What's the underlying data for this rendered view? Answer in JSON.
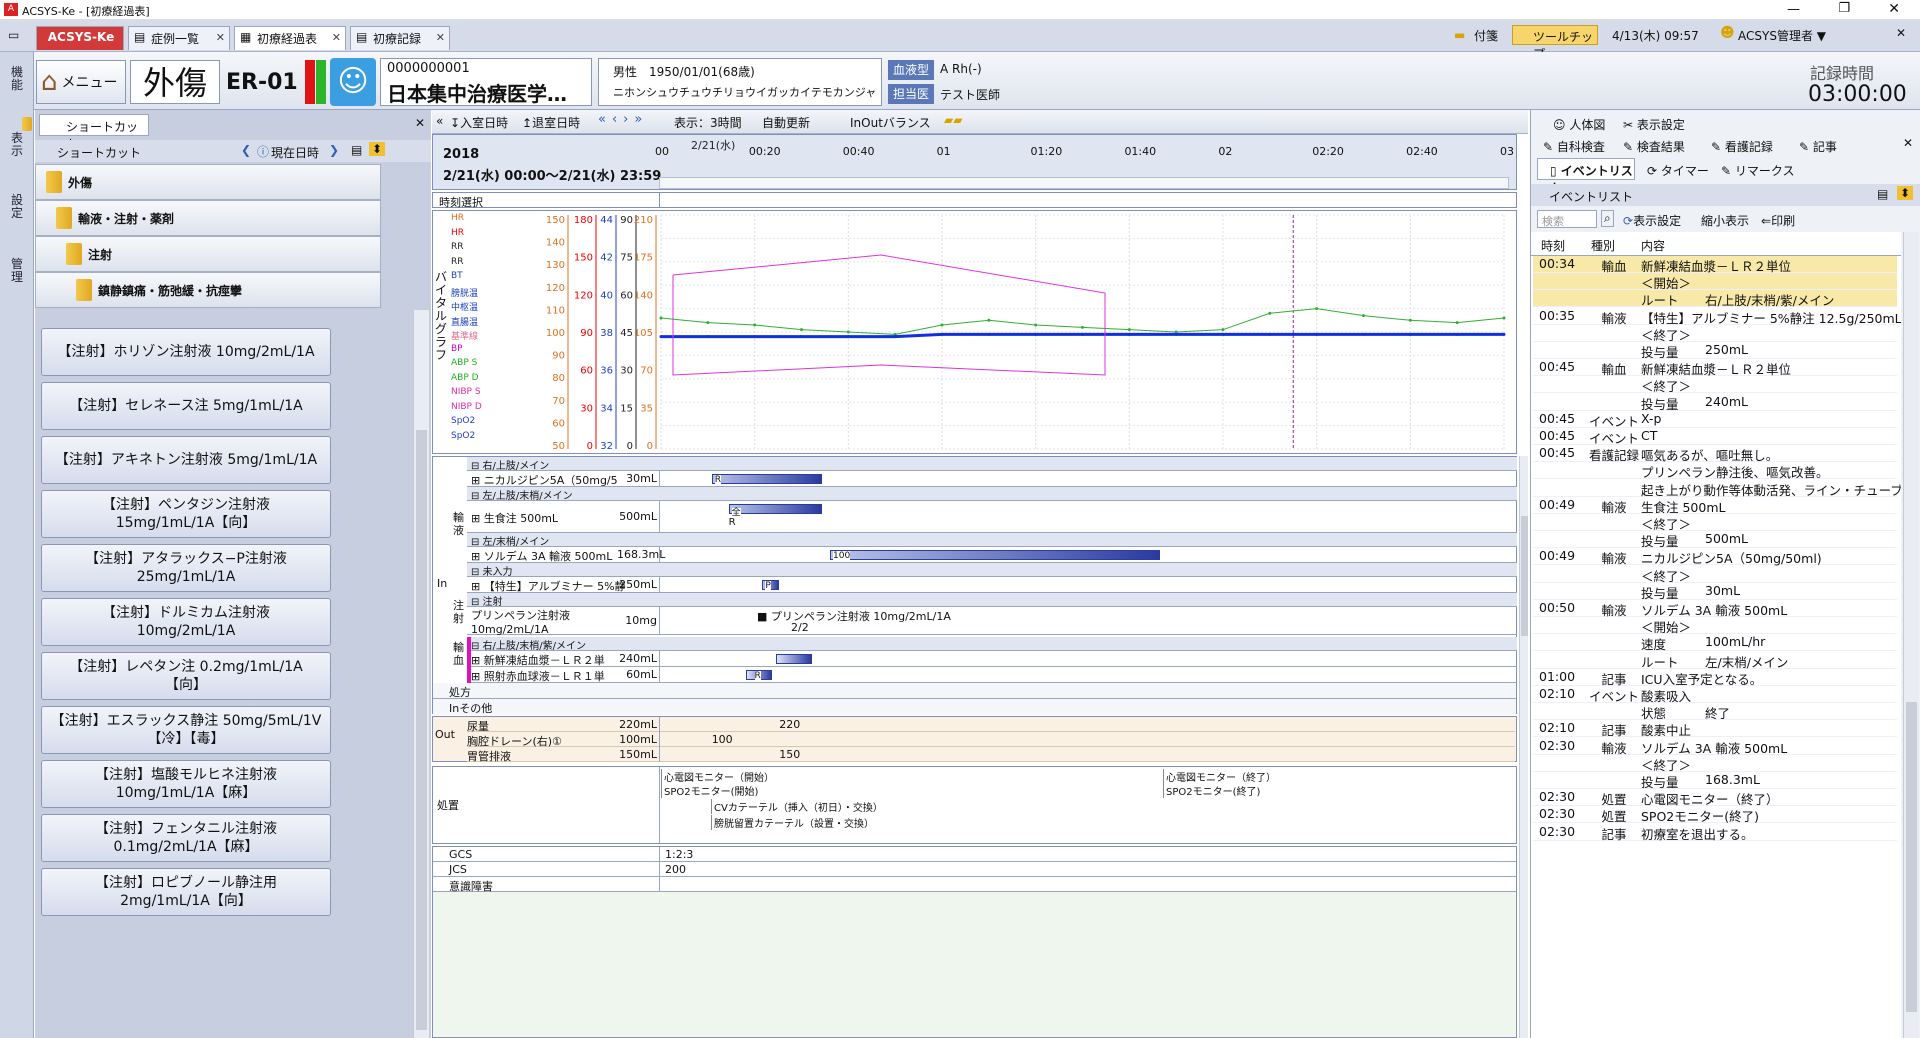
{
  "window": {
    "title": "ACSYS-Ke - [初療経過表]"
  },
  "tabs": [
    {
      "label": "ACSYS-Ke"
    },
    {
      "label": "症例一覧"
    },
    {
      "label": "初療経過表"
    },
    {
      "label": "初療記録"
    }
  ],
  "topright": {
    "attach": "付箋",
    "tooltip": "ツールチップ",
    "datetime": "4/13(木) 09:57",
    "user": "ACSYS管理者 ▼"
  },
  "header": {
    "menu": "メニュー",
    "dept": "外傷",
    "room": "ER-01",
    "patient_id": "0000000001",
    "patient_name": "日本集中治療医学…",
    "sex_dob": "男性　1950/01/01(68歳)",
    "kana": "ニホンシュウチュウチリョウイガッカイテモカンジャ",
    "blood_label": "血液型",
    "blood_value": "A Rh(-)",
    "doctor_label": "担当医",
    "doctor_value": "テスト医師",
    "record_time_label": "記録時間",
    "record_time_value": "03:00:00"
  },
  "left_vertical": [
    "機能",
    "表示",
    "設定",
    "管理"
  ],
  "shortcut": {
    "tab": "ショートカット",
    "header": "ショートカット",
    "now": "現在日時",
    "categories": [
      "外傷",
      "輸液・注射・薬剤",
      "注射",
      "鎮静鎮痛・筋弛緩・抗痙攣"
    ],
    "items": [
      "【注射】ホリゾン注射液 10mg/2mL/1A",
      "【注射】セレネース注 5mg/1mL/1A",
      "【注射】アキネトン注射液 5mg/1mL/1A",
      "【注射】ペンタジン注射液\n15mg/1mL/1A【向】",
      "【注射】アタラックス−P注射液\n25mg/1mL/1A",
      "【注射】ドルミカム注射液\n10mg/2mL/1A",
      "【注射】レペタン注 0.2mg/1mL/1A\n【向】",
      "【注射】エスラックス静注 50mg/5mL/1V\n【冷】【毒】",
      "【注射】塩酸モルヒネ注射液\n10mg/1mL/1A【麻】",
      "【注射】フェンタニル注射液\n0.1mg/2mL/1A【麻】",
      "【注射】ロピブノール静注用\n2mg/1mL/1A【向】"
    ]
  },
  "toolbar": {
    "in_time": "入室日時",
    "out_time": "退室日時",
    "display": "表示：3時間",
    "auto": "自動更新",
    "balance": "InOutバランス"
  },
  "timeline": {
    "year": "2018",
    "range": "2/21(水) 00:00〜2/21(水) 23:59",
    "date_marker": "2/21(水)",
    "ticks": [
      "00",
      "00:20",
      "00:40",
      "01",
      "01:20",
      "01:40",
      "02",
      "02:20",
      "02:40",
      "03"
    ]
  },
  "chart_section": {
    "time_select": "時刻選択",
    "vital_label": "バイタルグラフ",
    "legend": [
      "HR",
      "HR",
      "RR",
      "RR",
      "BT",
      "膀胱温",
      "中枢温",
      "直腸温",
      "基準線",
      "BP",
      "ABP S",
      "ABP D",
      "NIBP S",
      "NIBP D",
      "SpO2",
      "SpO2"
    ],
    "axis1": [
      "150",
      "140",
      "130",
      "120",
      "110",
      "100",
      "90",
      "80",
      "70",
      "60",
      "50"
    ],
    "axis2": [
      "180",
      "150",
      "120",
      "90",
      "60",
      "30",
      "0"
    ],
    "axis3": [
      "44",
      "42",
      "40",
      "38",
      "36",
      "34",
      "32"
    ],
    "axis4": [
      "90",
      "75",
      "60",
      "45",
      "30",
      "15",
      "0"
    ],
    "axis5": [
      "210",
      "175",
      "140",
      "105",
      "70",
      "35",
      "0"
    ]
  },
  "chart_data": {
    "type": "line",
    "title": "",
    "x": [
      "00:00",
      "00:10",
      "00:20",
      "00:30",
      "00:40",
      "00:50",
      "01:00",
      "01:10",
      "01:20",
      "01:30",
      "01:40",
      "01:50",
      "02:00",
      "02:10",
      "02:20",
      "02:30",
      "02:40",
      "02:50",
      "03:00"
    ],
    "series": [
      {
        "name": "HR",
        "values": [
          106,
          104,
          103,
          101,
          100,
          99,
          103,
          105,
          103,
          102,
          101,
          100,
          101,
          108,
          110,
          107,
          105,
          104,
          106
        ]
      },
      {
        "name": "SpO2",
        "values": [
          98,
          98,
          98,
          98,
          98,
          98,
          99,
          99,
          99,
          99,
          99,
          99,
          99,
          99,
          99,
          99,
          99,
          99,
          99
        ]
      }
    ],
    "ylim": [
      50,
      150
    ]
  },
  "infusion": {
    "group_label": "輸液",
    "in_label": "In",
    "rows": [
      {
        "route": "右/上肢/メイン",
        "name": "ニカルジピン5A（50mg/5",
        "vol": "30mL",
        "mark": "R"
      },
      {
        "route": "左/上肢/末梢/メイン",
        "name": "生食注 500mL",
        "vol": "500mL",
        "mark": "全",
        "mark2": "R"
      },
      {
        "route": "左/末梢/メイン",
        "name": "ソルデム 3A 輸液 500mL",
        "vol": "168.3mL",
        "mark": "100"
      },
      {
        "route": "未入力",
        "name": "【特生】アルブミナー 5%静",
        "vol": "250mL",
        "mark": "P"
      }
    ],
    "inj_group": "注射",
    "inj_sub": "注射",
    "inj_name": "プリンペラン注射液\n10mg/2mL/1A",
    "inj_vol": "10mg",
    "inj_bar": "プリンペラン注射液 10mg/2mL/1A",
    "inj_count": "2/2",
    "tr_group": "輸血",
    "tr_route": "右/上肢/末梢/紫/メイン",
    "tr_rows": [
      {
        "name": "新鮮凍結血漿－ＬＲ２単",
        "vol": "240mL"
      },
      {
        "name": "照射赤血球液－ＬＲ１単",
        "vol": "60mL",
        "mark": "R"
      }
    ],
    "rx": "処方",
    "in_other": "Inその他"
  },
  "out": {
    "label": "Out",
    "rows": [
      {
        "name": "尿量",
        "vol": "220mL",
        "val": "220"
      },
      {
        "name": "胸腔ドレーン(右)①",
        "vol": "100mL",
        "val": "100"
      },
      {
        "name": "胃管排液",
        "vol": "150mL",
        "val": "150"
      }
    ]
  },
  "procedures": {
    "label": "処置",
    "items": [
      "心電図モニター（開始）",
      "SPO2モニター(開始)",
      "CVカテーテル（挿入（初日）・交換）",
      "膀胱留置カテーテル（設置・交換）",
      "心電図モニター（終了）",
      "SPO2モニター(終了)"
    ]
  },
  "scores": [
    {
      "name": "GCS",
      "val": "1:2:3"
    },
    {
      "name": "JCS",
      "val": "200"
    },
    {
      "name": "意識障害",
      "val": ""
    }
  ],
  "right_panel": {
    "tabs1": [
      "人体図",
      "表示設定"
    ],
    "tabs2": [
      "自科検査",
      "検査結果",
      "看護記録",
      "記事"
    ],
    "tabs3": [
      "イベントリスト",
      "タイマー",
      "リマークス"
    ],
    "event_header": "イベントリスト",
    "search_placeholder": "検索",
    "show_settings": "表示設定",
    "shrink": "縮小表示",
    "print": "印刷",
    "cols": [
      "時刻",
      "種別",
      "内容"
    ],
    "rows": [
      {
        "t": "00:34",
        "k": "輸血",
        "c": "新鮮凍結血漿－ＬＲ２単位",
        "hl": true
      },
      {
        "t": "",
        "k": "",
        "c": "＜開始＞",
        "hl": true
      },
      {
        "t": "",
        "k": "",
        "c": "ルート",
        "c2": "右/上肢/末梢/紫/メイン",
        "hl": true
      },
      {
        "t": "00:35",
        "k": "輸液",
        "c": "【特生】アルブミナー 5%静注 12.5g/250mL"
      },
      {
        "t": "",
        "k": "",
        "c": "＜終了＞"
      },
      {
        "t": "",
        "k": "",
        "c": "投与量",
        "c2": "250mL"
      },
      {
        "t": "00:45",
        "k": "輸血",
        "c": "新鮮凍結血漿－ＬＲ２単位"
      },
      {
        "t": "",
        "k": "",
        "c": "＜終了＞"
      },
      {
        "t": "",
        "k": "",
        "c": "投与量",
        "c2": "240mL"
      },
      {
        "t": "00:45",
        "k": "イベント",
        "c": "X-p"
      },
      {
        "t": "00:45",
        "k": "イベント",
        "c": "CT"
      },
      {
        "t": "00:45",
        "k": "看護記録",
        "c": "嘔気あるが、嘔吐無し。"
      },
      {
        "t": "",
        "k": "",
        "c": "プリンペラン静注後、嘔気改善。"
      },
      {
        "t": "",
        "k": "",
        "c": "起き上がり動作等体動活発、ライン・チューブ類"
      },
      {
        "t": "00:49",
        "k": "輸液",
        "c": "生食注 500mL"
      },
      {
        "t": "",
        "k": "",
        "c": "＜終了＞"
      },
      {
        "t": "",
        "k": "",
        "c": "投与量",
        "c2": "500mL"
      },
      {
        "t": "00:49",
        "k": "輸液",
        "c": "ニカルジピン5A（50mg/50ml)"
      },
      {
        "t": "",
        "k": "",
        "c": "＜終了＞"
      },
      {
        "t": "",
        "k": "",
        "c": "投与量",
        "c2": "30mL"
      },
      {
        "t": "00:50",
        "k": "輸液",
        "c": "ソルデム 3A 輸液 500mL"
      },
      {
        "t": "",
        "k": "",
        "c": "＜開始＞"
      },
      {
        "t": "",
        "k": "",
        "c": "速度",
        "c2": "100mL/hr"
      },
      {
        "t": "",
        "k": "",
        "c": "ルート",
        "c2": "左/末梢/メイン"
      },
      {
        "t": "01:00",
        "k": "記事",
        "c": "ICU入室予定となる。"
      },
      {
        "t": "02:10",
        "k": "イベント",
        "c": "酸素吸入"
      },
      {
        "t": "",
        "k": "",
        "c": "状態",
        "c2": "終了"
      },
      {
        "t": "02:10",
        "k": "記事",
        "c": "酸素中止"
      },
      {
        "t": "02:30",
        "k": "輸液",
        "c": "ソルデム 3A 輸液 500mL"
      },
      {
        "t": "",
        "k": "",
        "c": "＜終了＞"
      },
      {
        "t": "",
        "k": "",
        "c": "投与量",
        "c2": "168.3mL"
      },
      {
        "t": "02:30",
        "k": "処置",
        "c": "心電図モニター（終了）"
      },
      {
        "t": "02:30",
        "k": "処置",
        "c": "SPO2モニター(終了)"
      },
      {
        "t": "02:30",
        "k": "記事",
        "c": "初療室を退出する。"
      }
    ]
  }
}
